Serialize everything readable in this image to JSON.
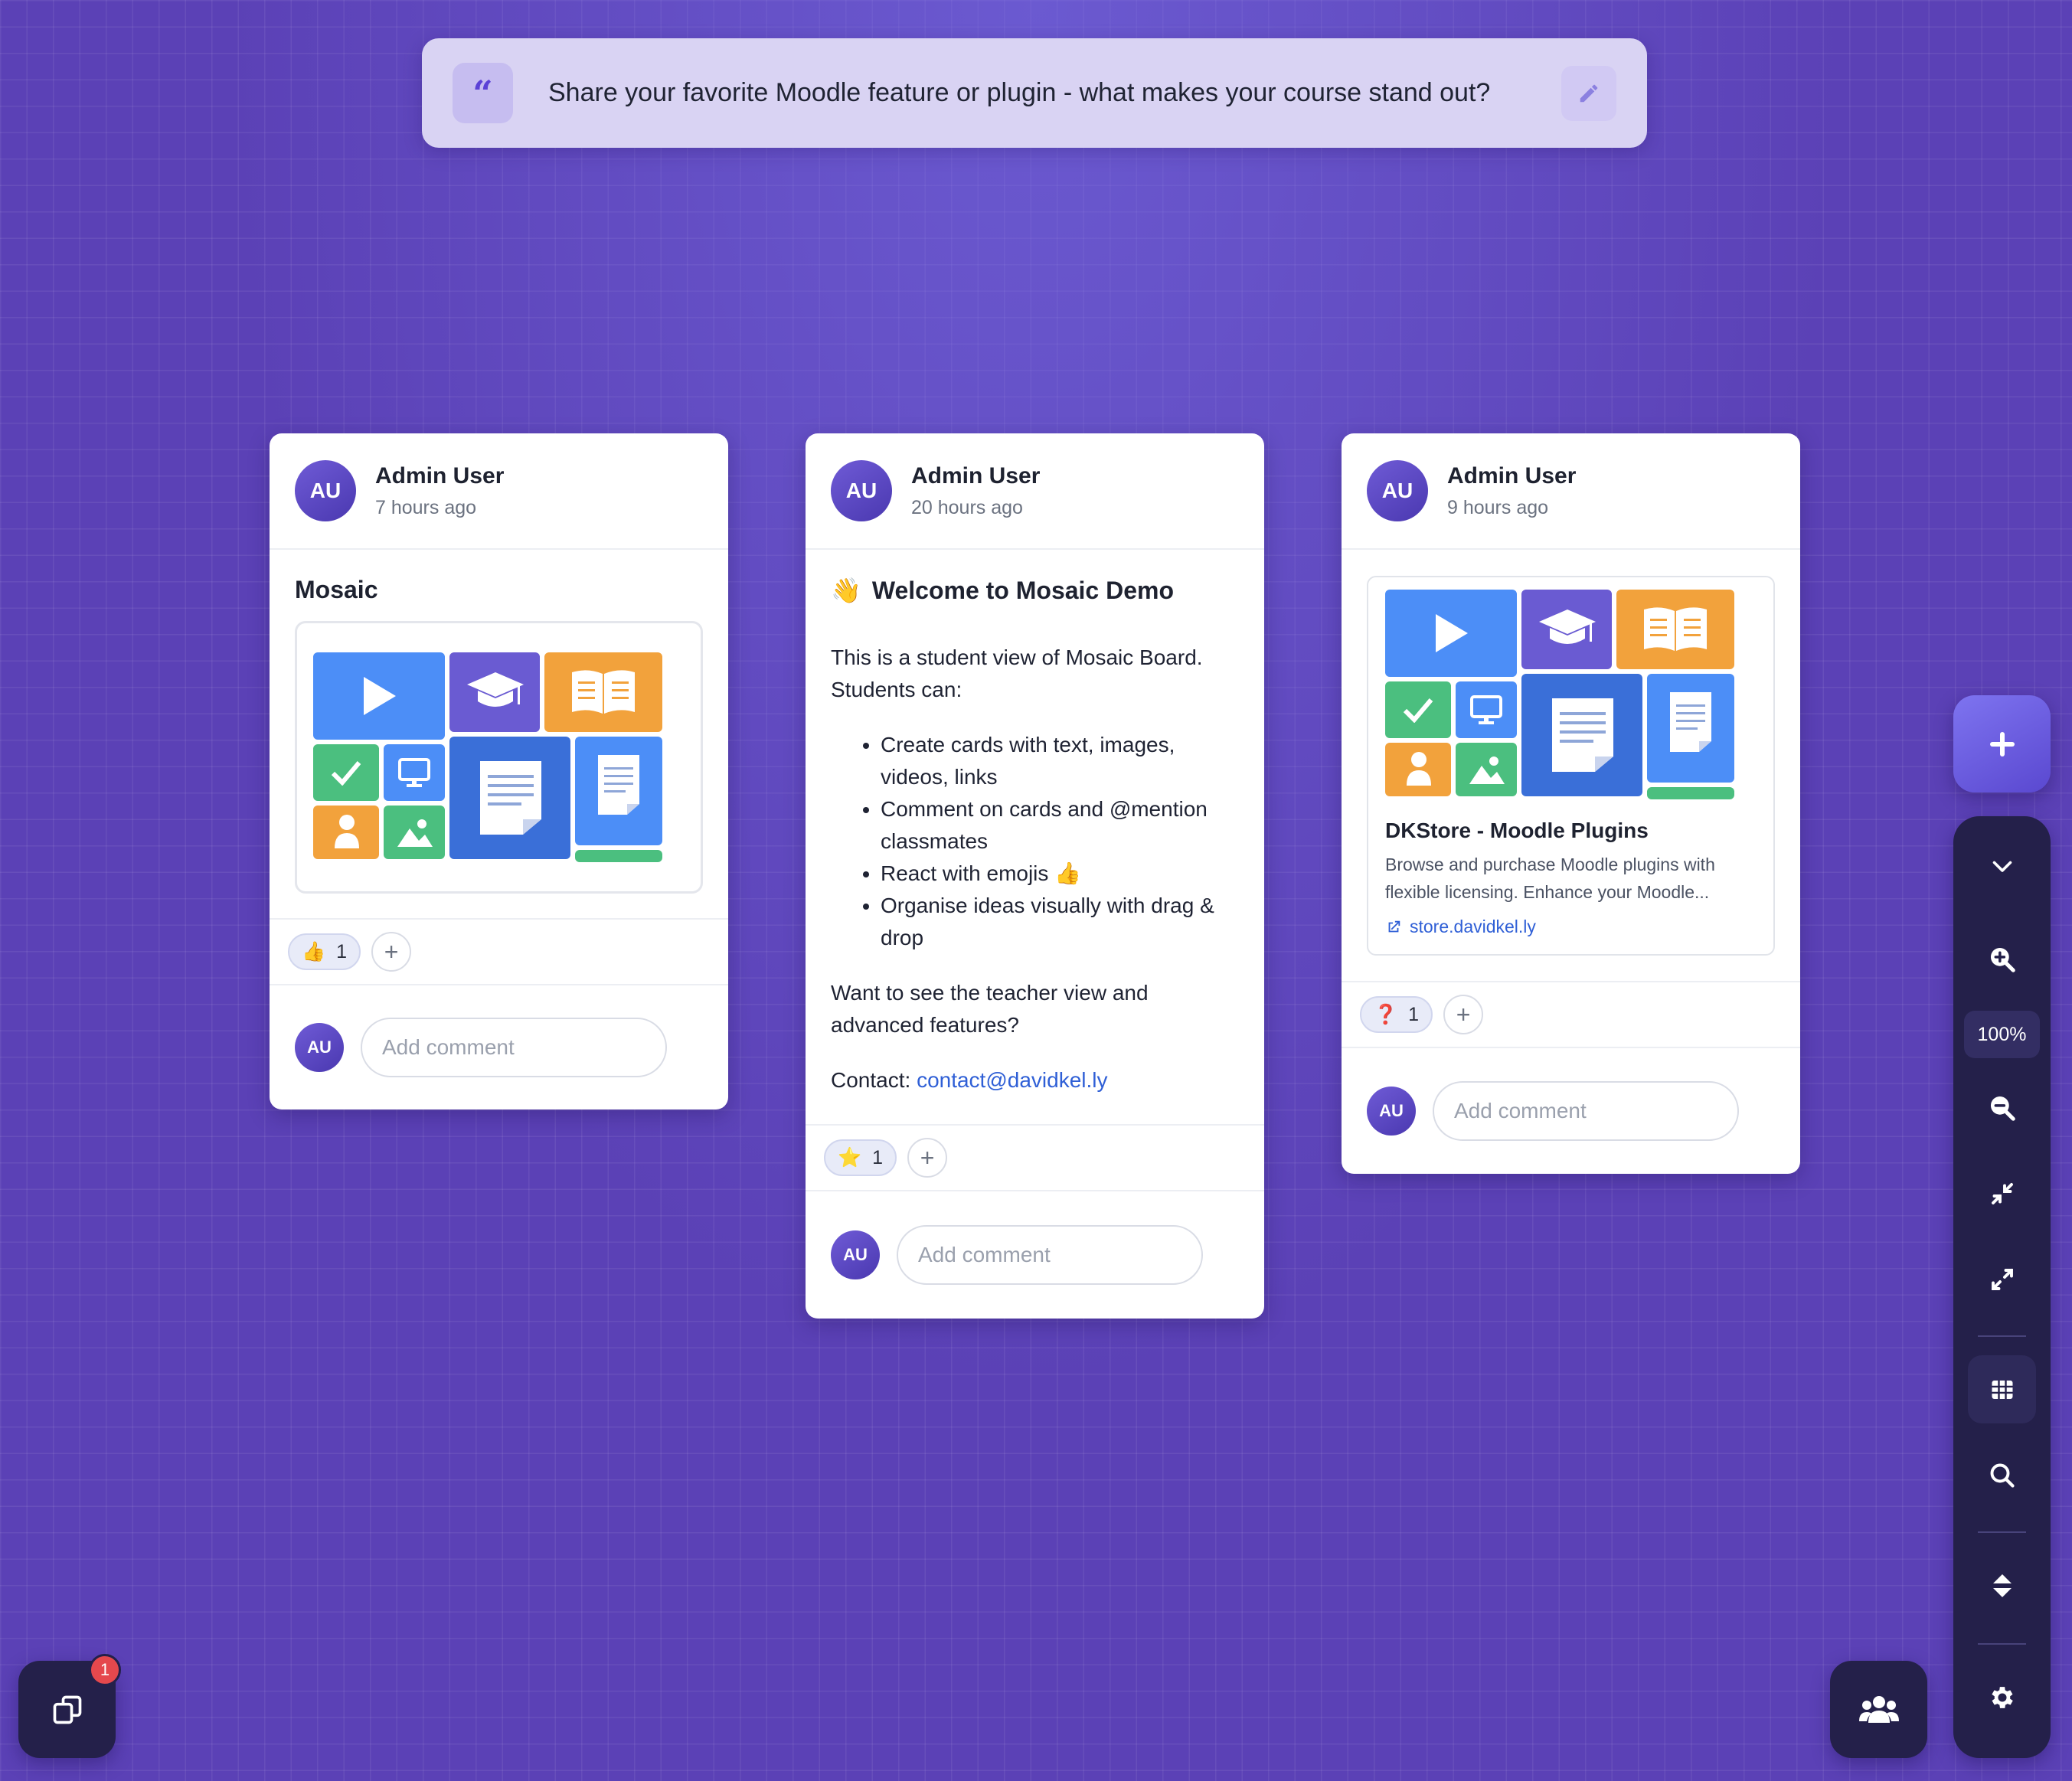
{
  "prompt": {
    "text": "Share your favorite Moodle feature or plugin - what makes your course stand out?"
  },
  "cards": [
    {
      "author": "Admin User",
      "initials": "AU",
      "time": "7 hours ago",
      "title": "Mosaic",
      "reaction_emoji": "👍",
      "reaction_count": "1",
      "comment_placeholder": "Add comment",
      "comment_initials": "AU"
    },
    {
      "author": "Admin User",
      "initials": "AU",
      "time": "20 hours ago",
      "title_emoji": "👋",
      "title": "Welcome to Mosaic Demo",
      "intro": "This is a student view of Mosaic Board. Students can:",
      "bullets": [
        "Create cards with text, images, videos, links",
        "Comment on cards and @mention classmates",
        "React with emojis 👍",
        "Organise ideas visually with drag & drop"
      ],
      "outro": "Want to see the teacher view and advanced features?",
      "contact_label": "Contact: ",
      "contact_email": "contact@davidkel.ly",
      "reaction_emoji": "⭐",
      "reaction_count": "1",
      "comment_placeholder": "Add comment",
      "comment_initials": "AU"
    },
    {
      "author": "Admin User",
      "initials": "AU",
      "time": "9 hours ago",
      "link_title": "DKStore - Moodle Plugins",
      "link_description": "Browse and purchase Moodle plugins with flexible licensing. Enhance your Moodle...",
      "link_url": "store.davidkel.ly",
      "reaction_emoji": "❓",
      "reaction_count": "1",
      "comment_placeholder": "Add comment",
      "comment_initials": "AU"
    }
  ],
  "toolbar": {
    "zoom": "100%"
  },
  "notifications": {
    "count": "1"
  },
  "colors": {
    "background": "#5b41b6",
    "accent": "#6a5ae0",
    "toolbar": "#24204a",
    "link": "#2f5fd6"
  }
}
